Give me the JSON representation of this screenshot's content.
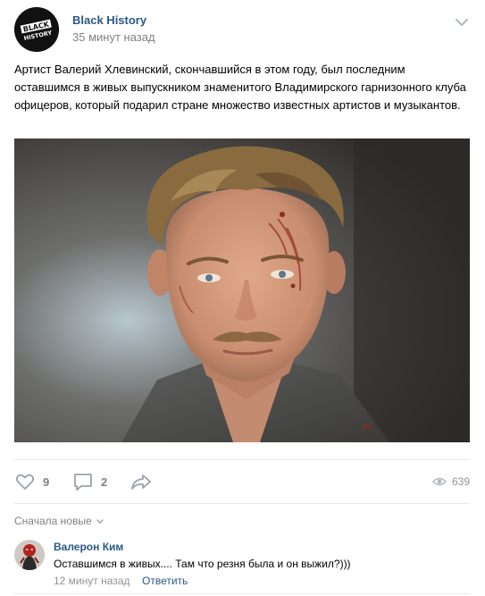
{
  "post": {
    "author": "Black History",
    "time": "35 минут назад",
    "text": "Артист Валерий Хлевинский, скончавшийся в этом году, был последним оставшимся в живых выпускником знаменитого Владимирского гарнизонного клуба офицеров, который подарил стране множество известных артистов и музыкантов.",
    "avatar_logo": [
      "BLACK",
      "HISTORY"
    ],
    "image": "portrait-photo"
  },
  "actions": {
    "likes": "9",
    "comments": "2",
    "views": "639"
  },
  "comments": {
    "sort_label": "Сначала новые",
    "items": [
      {
        "author": "Валерон Ким",
        "text": "Оставшимся в живых.... Там что резня была и он выжил?)))",
        "time": "12 минут назад",
        "reply_label": "Ответить"
      }
    ]
  },
  "colors": {
    "link": "#2a5885",
    "muted": "#828282",
    "divider": "#e7e8ec"
  },
  "icons": [
    "chevron-down-icon",
    "heart-icon",
    "comment-icon",
    "share-icon",
    "eye-icon"
  ]
}
